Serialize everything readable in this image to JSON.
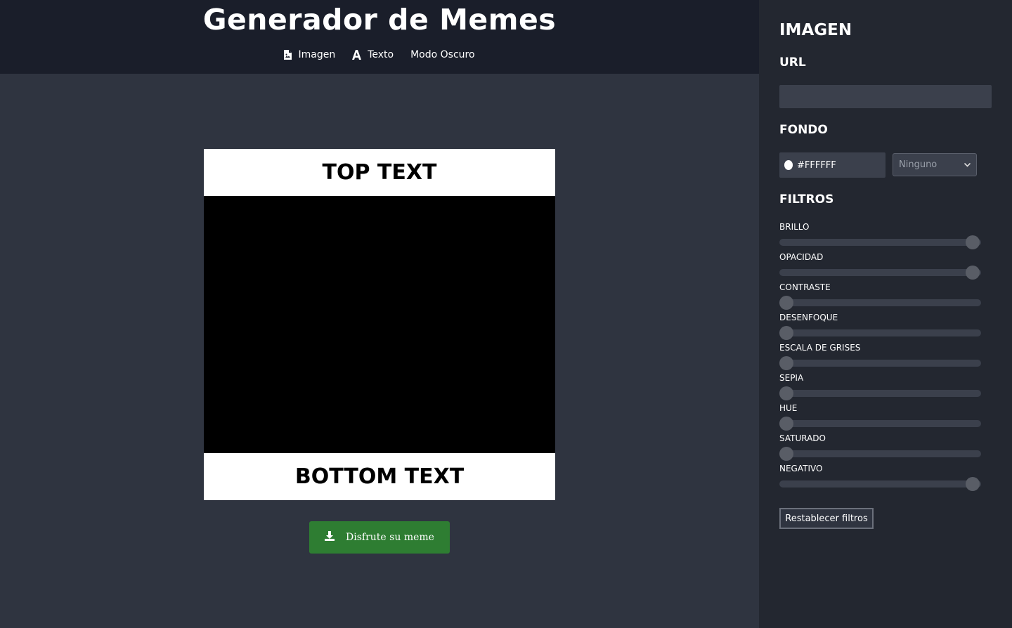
{
  "header": {
    "title": "Generador de Memes",
    "nav": [
      {
        "icon": "file-image-icon",
        "label": "Imagen"
      },
      {
        "icon": "font-icon",
        "label": "Texto"
      },
      {
        "icon": "",
        "label": "Modo Oscuro"
      }
    ]
  },
  "meme": {
    "top_text": "TOP TEXT",
    "bottom_text": "BOTTOM TEXT",
    "image_color": "#000000",
    "background_color": "#FFFFFF"
  },
  "download": {
    "icon": "download-icon",
    "label": "Disfrute su meme",
    "color": "#2e7d32"
  },
  "panel": {
    "title": "IMAGEN",
    "url_label": "URL",
    "url_value": "",
    "background_label": "FONDO",
    "background_color": "#FFFFFF",
    "blend_mode": "Ninguno",
    "filters_label": "FILTROS",
    "filters": [
      {
        "label": "BRILLO",
        "value": 1
      },
      {
        "label": "OPACIDAD",
        "value": 1
      },
      {
        "label": "CONTRASTE",
        "value": 0
      },
      {
        "label": "DESENFOQUE",
        "value": 0
      },
      {
        "label": "ESCALA DE GRISES",
        "value": 0
      },
      {
        "label": "SEPIA",
        "value": 0
      },
      {
        "label": "HUE",
        "value": 0
      },
      {
        "label": "SATURADO",
        "value": 0
      },
      {
        "label": "NEGATIVO",
        "value": 1
      }
    ],
    "reset_label": "Restablecer filtros"
  }
}
